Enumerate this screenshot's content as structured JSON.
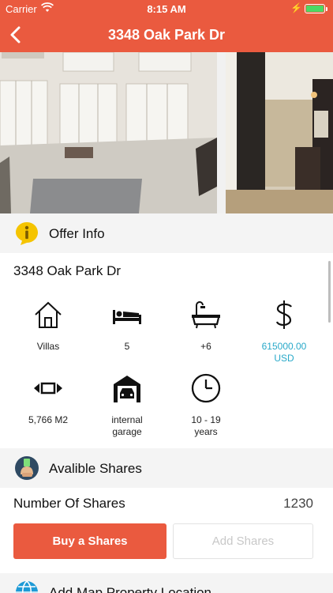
{
  "status_bar": {
    "carrier": "Carrier",
    "time": "8:15 AM",
    "battery_level": 1.0
  },
  "nav": {
    "title": "3348 Oak Park Dr"
  },
  "offer_section": {
    "label": "Offer Info"
  },
  "property": {
    "address": "3348 Oak Park Dr",
    "features": [
      {
        "icon": "house-icon",
        "value": "Villas"
      },
      {
        "icon": "bed-icon",
        "value": "5"
      },
      {
        "icon": "bathtub-icon",
        "value": "+6"
      },
      {
        "icon": "dollar-icon",
        "value": "615000.00\nUSD"
      },
      {
        "icon": "area-arrows-icon",
        "value": "5,766 M2"
      },
      {
        "icon": "garage-icon",
        "value": "internal\ngarage"
      },
      {
        "icon": "clock-icon",
        "value": "10 - 19\nyears"
      }
    ]
  },
  "shares_section": {
    "label": "Avalible Shares"
  },
  "shares": {
    "label": "Number Of Shares",
    "value": "1230"
  },
  "buttons": {
    "buy": "Buy a Shares",
    "add": "Add Shares"
  },
  "map_section": {
    "label": "Add Map Property Location"
  },
  "colors": {
    "brand": "#ea5a3f",
    "accent": "#29a9c9",
    "badge_yellow": "#f5c400"
  }
}
